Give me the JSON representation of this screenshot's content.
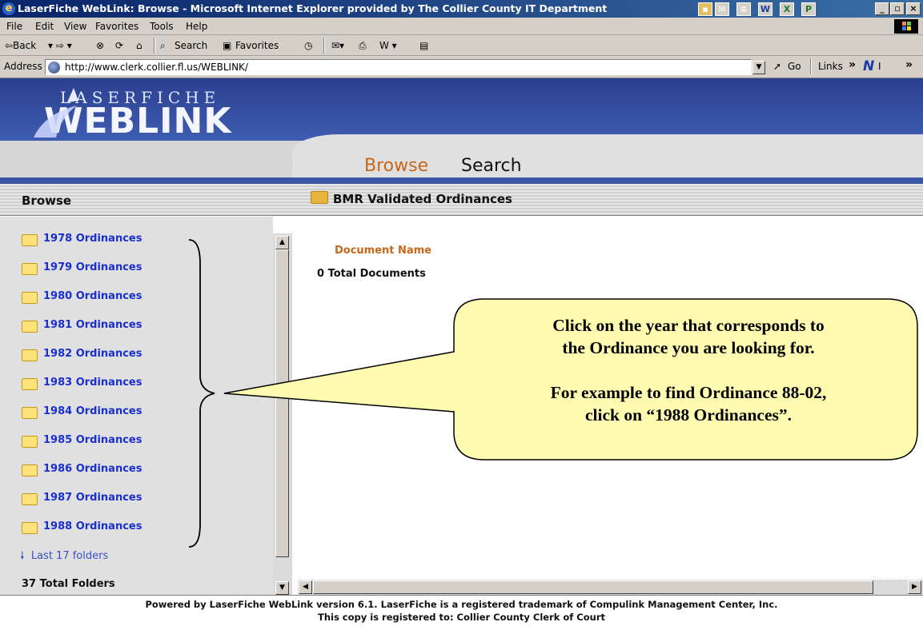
{
  "window": {
    "title": "LaserFiche WebLink: Browse - Microsoft Internet Explorer provided by The Collier County IT Department",
    "controls": [
      "_",
      "̅",
      "x"
    ]
  },
  "menu": [
    "File",
    "Edit",
    "View",
    "Favorites",
    "Tools",
    "Help"
  ],
  "toolbar": {
    "back": "⇦Back",
    "search": "Search",
    "favorites": "Favorites"
  },
  "address": {
    "label": "Address",
    "url": "http://www.clerk.collier.fl.us/WEBLINK/",
    "go": "Go",
    "links": "Links",
    "chevrons": "»"
  },
  "logo": {
    "top": "LASERFICHE",
    "bottom": "WEBLINK"
  },
  "tabs": {
    "browse": "Browse",
    "search": "Search"
  },
  "section": {
    "left_title": "Browse",
    "folder_title": "BMR Validated Ordinances"
  },
  "folders": [
    "1978 Ordinances",
    "1979 Ordinances",
    "1980 Ordinances",
    "1981 Ordinances",
    "1982 Ordinances",
    "1983 Ordinances",
    "1984 Ordinances",
    "1985 Ordinances",
    "1986 Ordinances",
    "1987 Ordinances",
    "1988 Ordinances"
  ],
  "last_folders_link": "Last 17 folders",
  "total_folders": "37 Total Folders",
  "documents": {
    "header": "Document Name",
    "total": "0 Total Documents"
  },
  "callout": {
    "line1": "Click on the year that corresponds to",
    "line2": "the Ordinance you are looking for.",
    "line3": "For example to find Ordinance 88-02,",
    "line4": "click on “1988 Ordinances”."
  },
  "footer": {
    "line1": "Powered by LaserFiche WebLink version 6.1. LaserFiche is a registered trademark of Compulink Management Center, Inc.",
    "line2": "This copy is registered to: Collier County Clerk of Court"
  },
  "colors": {
    "title_bar": "#0a246a",
    "link_blue": "#1a2fd0",
    "accent_orange": "#c8661a",
    "callout_fill": "#fffbb0"
  }
}
